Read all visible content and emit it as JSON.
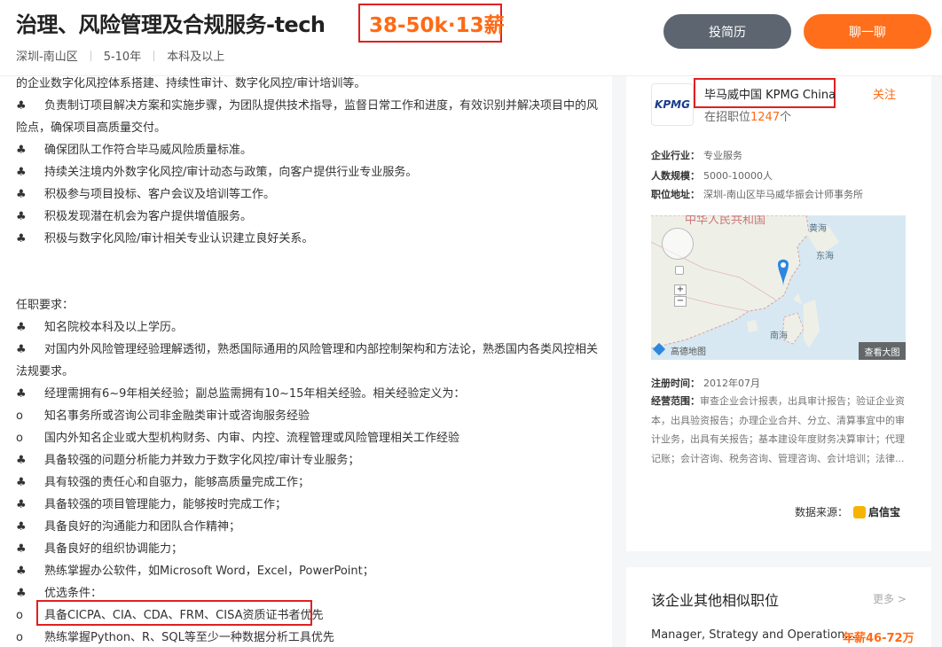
{
  "header": {
    "title": "治理、风险管理及合规服务-tech",
    "salary": "38-50k·13薪",
    "location": "深圳-南山区",
    "experience": "5-10年",
    "education": "本科及以上",
    "btn_resume": "投简历",
    "btn_chat": "聊一聊"
  },
  "content": {
    "lines": [
      {
        "bullet": "",
        "text": "的企业数字化风控体系搭建、持续性审计、数字化风控/审计培训等。"
      },
      {
        "bullet": "♣",
        "text": "负责制订项目解决方案和实施步骤，为团队提供技术指导，监督日常工作和进度，有效识别并解决项目中的风"
      },
      {
        "bullet": "",
        "text": "险点，确保项目高质量交付。"
      },
      {
        "bullet": "♣",
        "text": "确保团队工作符合毕马威风险质量标准。"
      },
      {
        "bullet": "♣",
        "text": "持续关注境内外数字化风控/审计动态与政策，向客户提供行业专业服务。"
      },
      {
        "bullet": "♣",
        "text": "积极参与项目投标、客户会议及培训等工作。"
      },
      {
        "bullet": "♣",
        "text": "积极发现潜在机会为客户提供增值服务。"
      },
      {
        "bullet": "♣",
        "text": "积极与数字化风险/审计相关专业认识建立良好关系。"
      },
      {
        "bullet": "",
        "text": "任职要求："
      },
      {
        "bullet": "♣",
        "text": "知名院校本科及以上学历。"
      },
      {
        "bullet": "♣",
        "text": "对国内外风险管理经验理解透彻，熟悉国际通用的风险管理和内部控制架构和方法论，熟悉国内各类风控相关"
      },
      {
        "bullet": "",
        "text": "法规要求。"
      },
      {
        "bullet": "♣",
        "text": "经理需拥有6~9年相关经验；副总监需拥有10~15年相关经验。相关经验定义为："
      },
      {
        "bullet": "o",
        "text": "知名事务所或咨询公司非金融类审计或咨询服务经验"
      },
      {
        "bullet": "o",
        "text": "国内外知名企业或大型机构财务、内审、内控、流程管理或风险管理相关工作经验"
      },
      {
        "bullet": "♣",
        "text": "具备较强的问题分析能力并致力于数字化风控/审计专业服务；"
      },
      {
        "bullet": "♣",
        "text": "具有较强的责任心和自驱力，能够高质量完成工作；"
      },
      {
        "bullet": "♣",
        "text": "具备较强的项目管理能力，能够按时完成工作；"
      },
      {
        "bullet": "♣",
        "text": "具备良好的沟通能力和团队合作精神；"
      },
      {
        "bullet": "♣",
        "text": "具备良好的组织协调能力；"
      },
      {
        "bullet": "♣",
        "text": "熟练掌握办公软件，如Microsoft Word，Excel，PowerPoint；"
      },
      {
        "bullet": "♣",
        "text": "优选条件："
      },
      {
        "bullet": "o",
        "text": "具备CICPA、CIA、CDA、FRM、CISA资质证书者优先"
      },
      {
        "bullet": "o",
        "text": "熟练掌握Python、R、SQL等至少一种数据分析工具优先"
      }
    ]
  },
  "company": {
    "logo_text": "KPMG",
    "name": "毕马威中国 KPMG China",
    "hiring_prefix": "在招职位",
    "hiring_count": "1247",
    "hiring_suffix": "个",
    "follow": "关注",
    "industry_label": "企业行业：",
    "industry": "专业服务",
    "size_label": "人数规模：",
    "size": "5000-10000人",
    "address_label": "职位地址：",
    "address": "深圳-南山区毕马威华振会计师事务所",
    "map": {
      "country": "中华人民共和国",
      "huanghai": "黄海",
      "donghai": "东海",
      "nanhai": "南海",
      "brand": "高德地图",
      "view_large": "查看大图",
      "zoom_in": "+",
      "zoom_out": "−"
    },
    "reg_label": "注册时间：",
    "reg_date": "2012年07月",
    "scope_label": "经营范围：",
    "scope": "审查企业会计报表，出具审计报告；验证企业资本，出具验资报告；办理企业合并、分立、清算事宜中的审计业务，出具有关报告；基本建设年度财务决算审计；代理记账；会计咨询、税务咨询、管理咨询、会计培训；法律...",
    "source_label": "数据来源：",
    "source_brand": "启信宝"
  },
  "similar": {
    "title": "该企业其他相似职位",
    "more": "更多 >",
    "item_title": "Manager, Strategy and Operation...",
    "item_salary": "年薪46-72万"
  }
}
